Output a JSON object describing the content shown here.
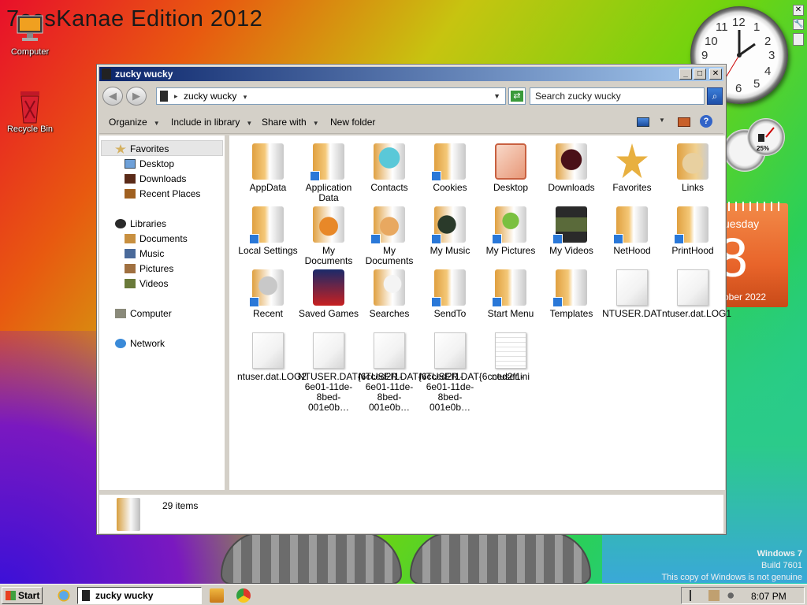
{
  "desktop": {
    "title_text": "7ossKanae Edition 2012",
    "icons": [
      {
        "label": "Computer"
      },
      {
        "label": "Recycle Bin"
      }
    ],
    "watermark": [
      "Windows 7",
      "Build 7601",
      "This copy of Windows is not genuine"
    ]
  },
  "gadgets": {
    "clock_numbers": [
      "12",
      "1",
      "2",
      "3",
      "4",
      "5",
      "6",
      "7",
      "8",
      "9",
      "10",
      "11"
    ],
    "meter_percent": "25%",
    "calendar": {
      "day": "uesday",
      "date": "8",
      "month": "ober 2022"
    }
  },
  "window": {
    "title": "zucky wucky",
    "controls": {
      "minimize": "_",
      "maximize": "□",
      "close": "✕"
    },
    "address": {
      "crumb": "zucky wucky"
    },
    "search_placeholder": "Search zucky wucky",
    "toolbar": {
      "organize": "Organize",
      "include_in_library": "Include in library",
      "share_with": "Share with",
      "new_folder": "New folder",
      "help": "?"
    },
    "nav": {
      "favorites": "Favorites",
      "desktop": "Desktop",
      "downloads": "Downloads",
      "recent_places": "Recent Places",
      "libraries": "Libraries",
      "documents": "Documents",
      "music": "Music",
      "pictures": "Pictures",
      "videos": "Videos",
      "computer": "Computer",
      "network": "Network"
    },
    "files": [
      {
        "name": "AppData",
        "kind": "folder",
        "shortcut": false
      },
      {
        "name": "Application Data",
        "kind": "folder",
        "shortcut": true
      },
      {
        "name": "Contacts",
        "kind": "folder",
        "shortcut": false
      },
      {
        "name": "Cookies",
        "kind": "folder",
        "shortcut": true
      },
      {
        "name": "Desktop",
        "kind": "folder",
        "shortcut": false
      },
      {
        "name": "Downloads",
        "kind": "folder",
        "shortcut": false
      },
      {
        "name": "Favorites",
        "kind": "folder",
        "shortcut": false
      },
      {
        "name": "Links",
        "kind": "folder",
        "shortcut": false
      },
      {
        "name": "Local Settings",
        "kind": "folder",
        "shortcut": true
      },
      {
        "name": "My Documents",
        "kind": "folder",
        "shortcut": false
      },
      {
        "name": "My Documents",
        "kind": "folder",
        "shortcut": true
      },
      {
        "name": "My Music",
        "kind": "folder",
        "shortcut": true
      },
      {
        "name": "My Pictures",
        "kind": "folder",
        "shortcut": true
      },
      {
        "name": "My Videos",
        "kind": "folder",
        "shortcut": true
      },
      {
        "name": "NetHood",
        "kind": "folder",
        "shortcut": true
      },
      {
        "name": "PrintHood",
        "kind": "folder",
        "shortcut": true
      },
      {
        "name": "Recent",
        "kind": "folder",
        "shortcut": true
      },
      {
        "name": "Saved Games",
        "kind": "folder",
        "shortcut": false
      },
      {
        "name": "Searches",
        "kind": "folder",
        "shortcut": false
      },
      {
        "name": "SendTo",
        "kind": "folder",
        "shortcut": true
      },
      {
        "name": "Start Menu",
        "kind": "folder",
        "shortcut": true
      },
      {
        "name": "Templates",
        "kind": "folder",
        "shortcut": true
      },
      {
        "name": "NTUSER.DAT",
        "kind": "doc",
        "shortcut": false
      },
      {
        "name": "ntuser.dat.LOG1",
        "kind": "doc",
        "shortcut": false
      },
      {
        "name": "ntuser.dat.LOG2",
        "kind": "doc",
        "shortcut": false
      },
      {
        "name": "NTUSER.DAT{6cced2f1-6e01-11de-8bed-001e0b…",
        "kind": "doc",
        "shortcut": false
      },
      {
        "name": "NTUSER.DAT{6cced2f1-6e01-11de-8bed-001e0b…",
        "kind": "doc",
        "shortcut": false
      },
      {
        "name": "NTUSER.DAT{6cced2f1-6e01-11de-8bed-001e0b…",
        "kind": "doc",
        "shortcut": false
      },
      {
        "name": "ntuser.ini",
        "kind": "doc",
        "shortcut": false
      }
    ],
    "details": {
      "count": "29 items"
    }
  },
  "taskbar": {
    "start_label": "Start",
    "task_label": "zucky wucky",
    "time": "8:07 PM"
  }
}
